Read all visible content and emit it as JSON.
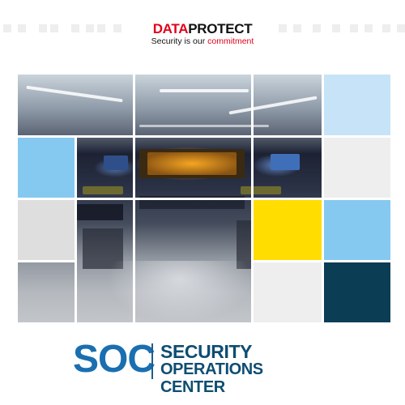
{
  "brand": {
    "name_part1": "DATA",
    "name_part2": "PROTECT",
    "tagline_part1": "Security is our ",
    "tagline_part2": "commitment"
  },
  "title": {
    "acronym": "SOC",
    "line1": "SECURITY",
    "line2": "OPERATIONS CENTER"
  },
  "colors": {
    "brand_red": "#e2001a",
    "soc_blue": "#1a6fb0",
    "navy": "#0e4d72",
    "tile_light_blue": "#85c9f0",
    "tile_pale_blue": "#c7e3f8",
    "tile_yellow": "#ffdd00",
    "tile_teal": "#0b3d55",
    "tile_gray": "#dedede",
    "tile_light_gray": "#eeeeee"
  }
}
